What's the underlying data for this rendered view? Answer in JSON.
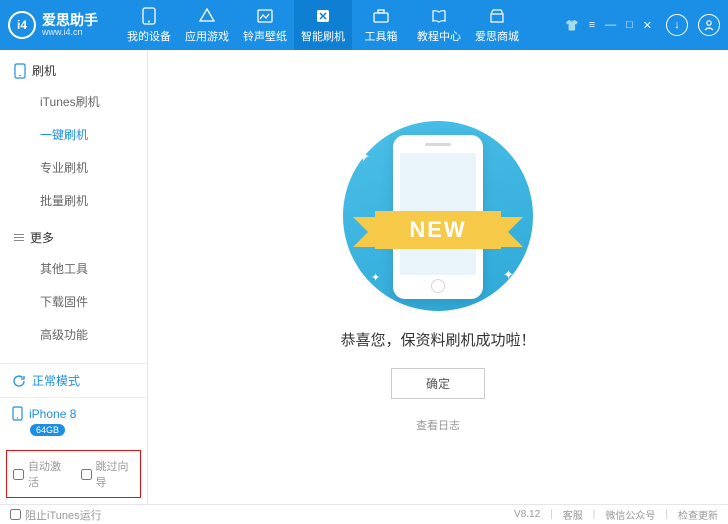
{
  "app": {
    "name": "爱思助手",
    "site": "www.i4.cn",
    "logo_text": "i4"
  },
  "tabs": [
    {
      "label": "我的设备"
    },
    {
      "label": "应用游戏"
    },
    {
      "label": "铃声壁纸"
    },
    {
      "label": "智能刷机"
    },
    {
      "label": "工具箱"
    },
    {
      "label": "教程中心"
    },
    {
      "label": "爱思商城"
    }
  ],
  "sidebar": {
    "section1": {
      "title": "刷机",
      "items": [
        "iTunes刷机",
        "一键刷机",
        "专业刷机",
        "批量刷机"
      ],
      "active_index": 1
    },
    "section2": {
      "title": "更多",
      "items": [
        "其他工具",
        "下载固件",
        "高级功能"
      ]
    }
  },
  "status": {
    "mode": "正常模式"
  },
  "device": {
    "name": "iPhone 8",
    "storage": "64GB"
  },
  "options": {
    "auto_activate": "自动激活",
    "skip_guide": "跳过向导"
  },
  "main": {
    "ribbon": "NEW",
    "success": "恭喜您，保资料刷机成功啦！",
    "ok": "确定",
    "view_log": "查看日志"
  },
  "footer": {
    "block_itunes": "阻止iTunes运行",
    "version": "V8.12",
    "support": "客服",
    "wechat": "微信公众号",
    "check_update": "检查更新"
  }
}
